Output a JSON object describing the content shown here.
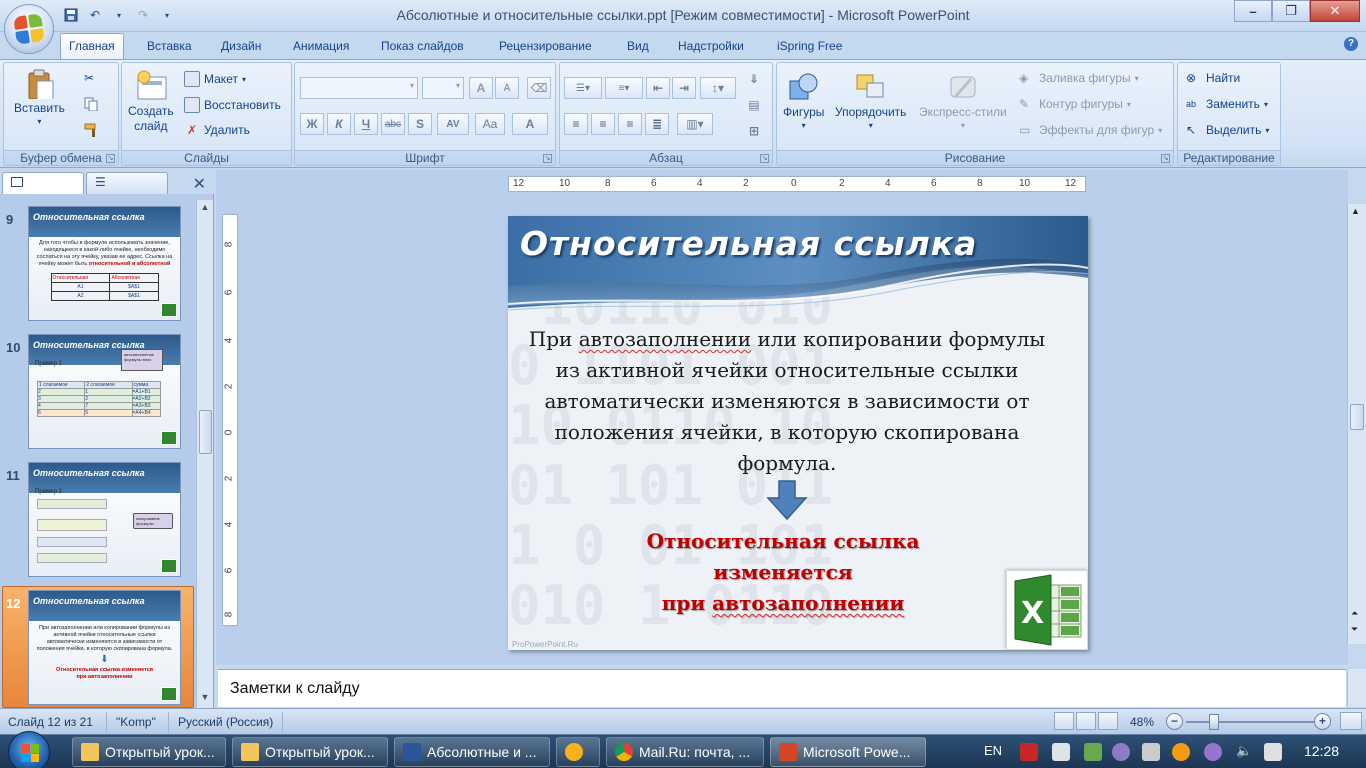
{
  "window": {
    "title": "Абсолютные и относительные ссылки.ppt [Режим совместимости] - Microsoft PowerPoint",
    "minimize": "–",
    "maximize": "❐",
    "close": "✕"
  },
  "ribbon_tabs": [
    "Главная",
    "Вставка",
    "Дизайн",
    "Анимация",
    "Показ слайдов",
    "Рецензирование",
    "Вид",
    "Надстройки",
    "iSpring Free"
  ],
  "ribbon": {
    "clipboard": {
      "label": "Буфер обмена",
      "paste": "Вставить"
    },
    "slides": {
      "label": "Слайды",
      "new_slide_1": "Создать",
      "new_slide_2": "слайд",
      "layout": "Макет",
      "reset": "Восстановить",
      "delete": "Удалить"
    },
    "font": {
      "label": "Шрифт",
      "bold": "Ж",
      "italic": "К",
      "underline": "Ч",
      "strike": "abc",
      "shadow": "S",
      "spacing": "AV",
      "case": "Aa",
      "color": "A",
      "grow": "A",
      "shrink": "A"
    },
    "paragraph": {
      "label": "Абзац"
    },
    "drawing": {
      "label": "Рисование",
      "shapes": "Фигуры",
      "arrange": "Упорядочить",
      "quick_styles": "Экспресс-стили",
      "fill": "Заливка фигуры",
      "outline": "Контур фигуры",
      "effects": "Эффекты для фигур"
    },
    "editing": {
      "label": "Редактирование",
      "find": "Найти",
      "replace": "Заменить",
      "select": "Выделить"
    }
  },
  "thumbnails": [
    {
      "num": "9",
      "title": "Относительная ссылка",
      "text": "Для того чтобы в формуле использовать значение, находящееся в какой-либо ячейке, необходимо сослаться на эту ячейку, указав ее адрес. Ссылка на ячейку может быть",
      "red": "относительной и абсолютной",
      "col1": "Относительная",
      "col2": "Абсолютная",
      "r1a": "A1",
      "r1b": "$A$1",
      "r2a": "A2",
      "r2b": "$A$1"
    },
    {
      "num": "10",
      "title": "Относительная ссылка",
      "example": "Пример 1",
      "callout": "автозаполнение формулы вниз",
      "h1": "1 слагаемое",
      "h2": "2 слагаемое",
      "h3": "сумма"
    },
    {
      "num": "11",
      "title": "Относительная ссылка",
      "example": "Пример 2",
      "callout": "копирование формулы"
    },
    {
      "num": "12",
      "title": "Относительная ссылка",
      "text": "При автозаполнении или копировании формулы из активной ячейки относительные ссылки автоматически изменяются в зависимости от положения ячейки, в которую скопирована формула.",
      "red": "Относительная ссылка изменяется при автозаполнении"
    }
  ],
  "thumb10_rows": [
    [
      "2",
      "1",
      "=A1+B1"
    ],
    [
      "3",
      "2",
      "=A2+B2"
    ],
    [
      "4",
      "7",
      "=A3+B3"
    ],
    [
      "6",
      "5",
      "=A4+B4"
    ]
  ],
  "ruler": {
    "h": [
      "12",
      "10",
      "8",
      "6",
      "4",
      "2",
      "0",
      "2",
      "4",
      "6",
      "8",
      "10",
      "12"
    ],
    "v": [
      "8",
      "6",
      "4",
      "2",
      "0",
      "2",
      "4",
      "6",
      "8"
    ]
  },
  "slide": {
    "title": "Относительная  ссылка",
    "body_pre": "При ",
    "body_u": "автозаполнении",
    "body_post": " или копировании формулы из активной ячейки относительные ссылки автоматически изменяются в зависимости от положения ячейки, в которую скопирована формула.",
    "red_line1": "Относительная ссылка",
    "red_line2": "изменяется",
    "red_line3_pre": "при ",
    "red_line3_u": "автозаполнении",
    "footer": "ProPowerPoint.Ru",
    "bg_digits": "01001101 0\n 10110 010\n0 1101 001\n10 0110 10\n01 101 011\n1 0 01 101\n010 1 0110"
  },
  "notes": {
    "placeholder": "Заметки к слайду"
  },
  "status": {
    "slide": "Слайд 12 из 21",
    "theme": "\"Komp\"",
    "language": "Русский (Россия)",
    "zoom": "48%"
  },
  "taskbar": {
    "items": [
      "Открытый урок...",
      "Открытый урок...",
      "Абсолютные и ...",
      "",
      "Mail.Ru: почта, ...",
      "Microsoft Powe..."
    ],
    "lang": "EN",
    "time": "12:28"
  },
  "colors": {
    "accent": "#15428b",
    "slide_red": "#c00000",
    "selected_thumb": "#f0a050"
  }
}
